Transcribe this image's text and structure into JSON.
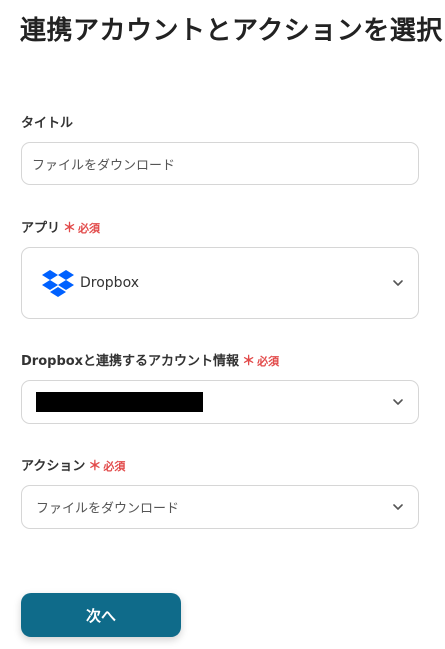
{
  "page": {
    "title": "連携アカウントとアクションを選択"
  },
  "fields": {
    "title_field": {
      "label": "タイトル",
      "value": "ファイルをダウンロード"
    },
    "app_field": {
      "label": "アプリ",
      "required_mark": "＊",
      "required_text": "必須",
      "value": "Dropbox",
      "icon": "dropbox-logo"
    },
    "account_field": {
      "label": "Dropboxと連携するアカウント情報",
      "required_mark": "＊",
      "required_text": "必須",
      "value": ""
    },
    "action_field": {
      "label": "アクション",
      "required_mark": "＊",
      "required_text": "必須",
      "value": "ファイルをダウンロード"
    }
  },
  "footer": {
    "next_label": "次へ"
  },
  "colors": {
    "primary": "#0f6b8a",
    "required": "#e24a4a",
    "dropbox": "#0061ff",
    "border": "#d6d6d6"
  }
}
